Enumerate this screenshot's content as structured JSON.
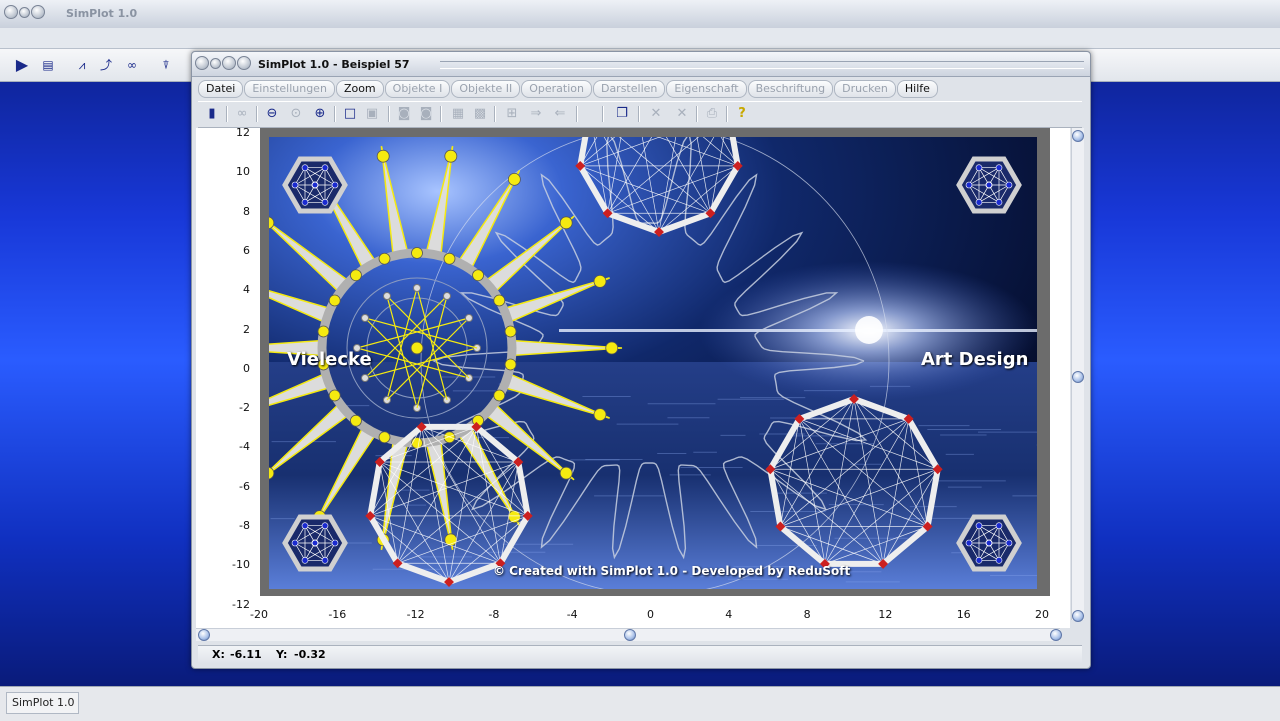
{
  "app": {
    "outer_title": "SimPlot 1.0",
    "window_title": "SimPlot 1.0 - Beispiel 57",
    "taskbar_label": "SimPlot 1.0"
  },
  "menu": [
    {
      "label": "Datei",
      "active": true
    },
    {
      "label": "Einstellungen",
      "active": false
    },
    {
      "label": "Zoom",
      "active": true
    },
    {
      "label": "Objekte I",
      "active": false
    },
    {
      "label": "Objekte II",
      "active": false
    },
    {
      "label": "Operation",
      "active": false
    },
    {
      "label": "Darstellen",
      "active": false
    },
    {
      "label": "Eigenschaft",
      "active": false
    },
    {
      "label": "Beschriftung",
      "active": false
    },
    {
      "label": "Drucken",
      "active": false
    },
    {
      "label": "Hilfe",
      "active": true
    }
  ],
  "axes": {
    "x_ticks": [
      "-20",
      "-16",
      "-12",
      "-8",
      "-4",
      "0",
      "4",
      "8",
      "12",
      "16",
      "20"
    ],
    "y_ticks": [
      "12",
      "10",
      "8",
      "6",
      "4",
      "2",
      "0",
      "-2",
      "-4",
      "-6",
      "-8",
      "-10",
      "-12"
    ]
  },
  "canvas_text": {
    "left_label": "Vielecke",
    "right_label": "Art Design",
    "credit": "© Created with SimPlot 1.0 - Developed by ReduSoft"
  },
  "status": {
    "x_label": "X:",
    "x_value": "-6.11",
    "y_label": "Y:",
    "y_value": "-0.32"
  },
  "colors": {
    "star_yellow": "#f5ea10",
    "node_red": "#cc2020",
    "node_blue": "#1a2ad0",
    "accent_blue": "#1a2a8a"
  }
}
